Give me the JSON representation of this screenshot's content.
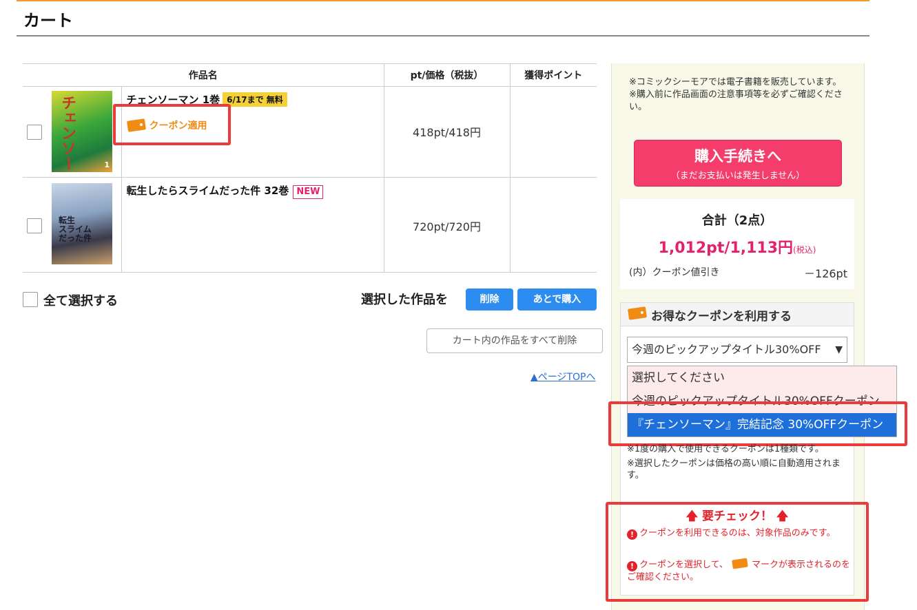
{
  "page": {
    "title": "カート"
  },
  "table": {
    "headers": {
      "title": "作品名",
      "price": "pt/価格（税抜）",
      "points": "獲得ポイント"
    },
    "rows": [
      {
        "title": "チェンソーマン 1巻",
        "badge": "6/17まで 無料",
        "coupon_label": "クーポン適用",
        "price": "418pt/418円"
      },
      {
        "title": "転生したらスライムだった件 32巻",
        "badge": "NEW",
        "price": "720pt/720円"
      }
    ]
  },
  "actions": {
    "select_all": "全て選択する",
    "selected_label": "選択した作品を",
    "delete": "削除",
    "buy_later": "あとで購入",
    "clear_cart": "カート内の作品をすべて削除",
    "page_top": "▲ページTOPへ"
  },
  "sidebar": {
    "note_lines": [
      "※コミックシーモアでは電子書籍を販売しています。",
      "※購入前に作品画面の注意事項等を必ずご確認ください。"
    ],
    "buy_button": {
      "label": "購入手続きへ",
      "sub": "（まだお支払いは発生しません）"
    },
    "total": {
      "heading": "合計（2点）",
      "price": "1,012pt/1,113円",
      "tax_note": "(税込)",
      "discount_label": "(内）クーポン値引き",
      "discount_value": "－126pt"
    },
    "coupon": {
      "heading": "お得なクーポンを利用する",
      "selected": "今週のピックアップタイトル30%OFF",
      "options": [
        "選択してください",
        "今週のピックアップタイトル30%OFFクーポン",
        "『チェンソーマン』完結記念 30%OFFクーポン"
      ],
      "notes": [
        "※1度の購入で使用できるクーポンは1種類です。",
        "※選択したクーポンは価格の高い順に自動適用されます。"
      ],
      "warning_heading": "要チェック！",
      "warnings": [
        "クーポンを利用できるのは、対象作品のみです。",
        "クーポンを選択して、",
        "マークが表示されるのをご確認ください。"
      ]
    }
  },
  "colors": {
    "accent_pink": "#e4226b",
    "coupon_orange": "#f08b14",
    "button_blue": "#2d8cf0",
    "highlight_red": "#ec3a3a"
  }
}
